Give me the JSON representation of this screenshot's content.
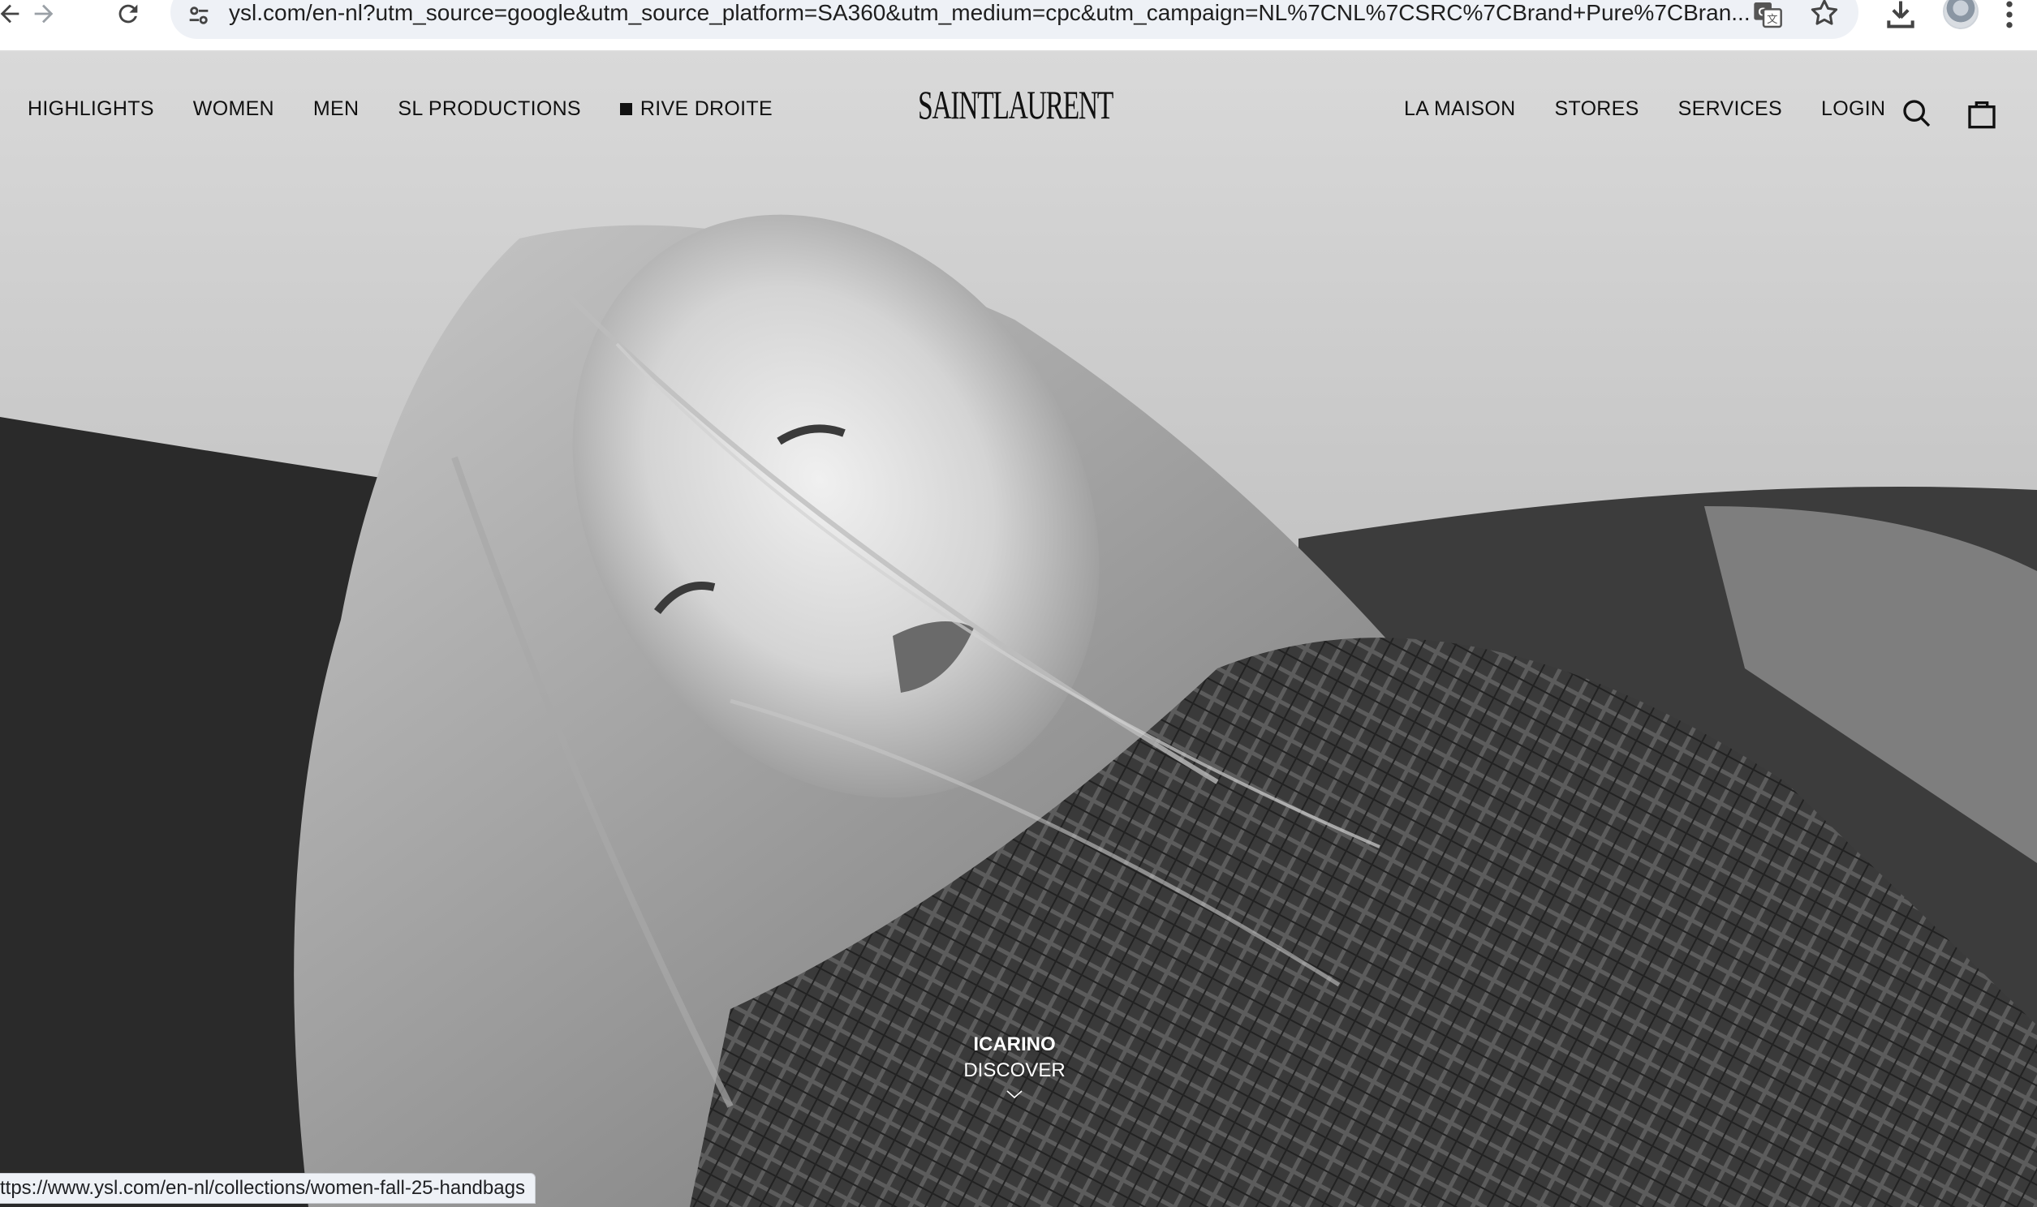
{
  "browser": {
    "url": "ysl.com/en-nl?utm_source=google&utm_source_platform=SA360&utm_medium=cpc&utm_campaign=NL%7CNL%7CSRC%7CBrand+Pure%7CBran...",
    "status_url": "ttps://www.ysl.com/en-nl/collections/women-fall-25-handbags"
  },
  "nav": {
    "left": [
      "HIGHLIGHTS",
      "WOMEN",
      "MEN",
      "SL PRODUCTIONS",
      "RIVE DROITE"
    ],
    "right": [
      "LA MAISON",
      "STORES",
      "SERVICES",
      "LOGIN"
    ],
    "logo_text": "SAINT LAURENT"
  },
  "hero": {
    "title": "ICARINO",
    "cta": "DISCOVER"
  },
  "icons": {
    "back": "arrow-left-icon",
    "forward": "arrow-right-icon",
    "reload": "reload-icon",
    "site_settings": "tune-icon",
    "translate": "translate-icon",
    "bookmark": "star-icon",
    "download": "download-icon",
    "menu": "kebab-menu-icon",
    "search": "search-icon",
    "bag": "shopping-bag-icon",
    "scroll": "chevron-down-icon"
  },
  "colors": {
    "nav_text": "#111111",
    "hero_text": "#ffffff",
    "omnibox_bg": "#eef1f6"
  }
}
